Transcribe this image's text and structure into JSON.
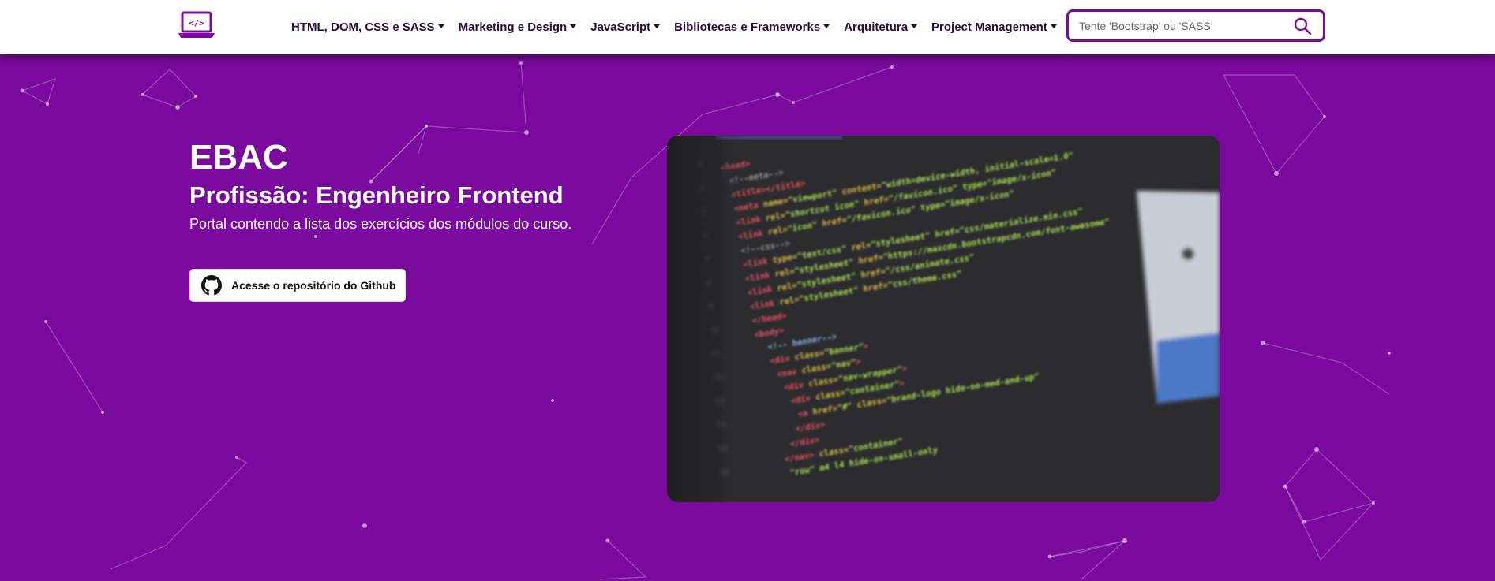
{
  "navbar": {
    "logo_icon": "laptop-code-icon",
    "menu": [
      {
        "label": "HTML, DOM, CSS e SASS"
      },
      {
        "label": "Marketing e Design"
      },
      {
        "label": "JavaScript"
      },
      {
        "label": "Bibliotecas e Frameworks"
      },
      {
        "label": "Arquitetura"
      },
      {
        "label": "Project Management"
      }
    ],
    "search": {
      "placeholder": "Tente 'Bootstrap' ou 'SASS'",
      "icon": "search-icon"
    }
  },
  "hero": {
    "title": "EBAC",
    "subtitle": "Profissão: Engenheiro Frontend",
    "description": "Portal contendo a lista dos exercícios dos módulos do curso.",
    "github_button": {
      "label": "Acesse o repositório do Github",
      "icon": "github-icon"
    }
  },
  "colors": {
    "primary": "#7a0a9e",
    "navbar_bg": "#ffffff",
    "nav_text": "#2a0a3a"
  }
}
